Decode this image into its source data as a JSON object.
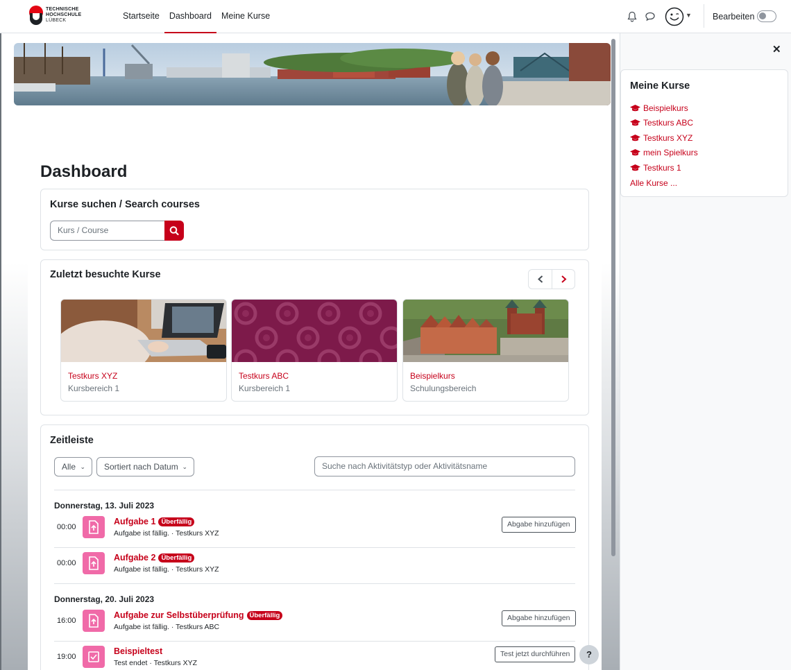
{
  "brand": {
    "logo_line1": "TECHNISCHE",
    "logo_line2": "HOCHSCHULE",
    "logo_line3": "LÜBECK",
    "accent_color": "#c6001a"
  },
  "navbar": {
    "links": [
      {
        "label": "Startseite",
        "active": false
      },
      {
        "label": "Dashboard",
        "active": true
      },
      {
        "label": "Meine Kurse",
        "active": false
      }
    ],
    "notifications_icon": "bell-icon",
    "messages_icon": "chat-icon",
    "user_menu_icon": "smiley-avatar-icon",
    "edit_mode_label": "Bearbeiten",
    "edit_mode_on": false
  },
  "main": {
    "title": "Dashboard",
    "search": {
      "title": "Kurse suchen / Search courses",
      "placeholder": "Kurs / Course",
      "button_icon": "search-icon"
    },
    "recent": {
      "title": "Zuletzt besuchte Kurse",
      "courses": [
        {
          "name": "Testkurs XYZ",
          "category": "Kursbereich 1",
          "image": "laptop-photo"
        },
        {
          "name": "Testkurs ABC",
          "category": "Kursbereich 1",
          "image": "purple-circle-pattern"
        },
        {
          "name": "Beispielkurs",
          "category": "Schulungsbereich",
          "image": "holstentor-aerial-photo"
        }
      ]
    },
    "timeline": {
      "title": "Zeitleiste",
      "filter_label": "Alle",
      "sort_label": "Sortiert nach Datum",
      "search_placeholder": "Suche nach Aktivitätstyp oder Aktivitätsname",
      "groups": [
        {
          "date": "Donnerstag, 13. Juli 2023",
          "items": [
            {
              "time": "00:00",
              "name": "Aufgabe 1",
              "badge": "Überfällig",
              "sub": "Aufgabe ist fällig. · Testkurs XYZ",
              "action": "Abgabe hinzufügen",
              "icon": "assignment-upload-icon"
            },
            {
              "time": "00:00",
              "name": "Aufgabe 2",
              "badge": "Überfällig",
              "sub": "Aufgabe ist fällig. · Testkurs XYZ",
              "action": "",
              "icon": "assignment-upload-icon"
            }
          ]
        },
        {
          "date": "Donnerstag, 20. Juli 2023",
          "items": [
            {
              "time": "16:00",
              "name": "Aufgabe zur Selbstüberprüfung",
              "badge": "Überfällig",
              "sub": "Aufgabe ist fällig. · Testkurs ABC",
              "action": "Abgabe hinzufügen",
              "icon": "assignment-upload-icon"
            },
            {
              "time": "19:00",
              "name": "Beispieltest",
              "badge": "",
              "sub": "Test endet · Testkurs XYZ",
              "action": "Test jetzt durchführen",
              "icon": "quiz-check-icon"
            }
          ]
        }
      ]
    },
    "help_label": "?"
  },
  "drawer": {
    "close_icon": "close-icon",
    "title": "Meine Kurse",
    "courses": [
      "Beispielkurs",
      "Testkurs ABC",
      "Testkurs XYZ",
      "mein Spielkurs",
      "Testkurs 1"
    ],
    "all_link": "Alle Kurse ..."
  }
}
